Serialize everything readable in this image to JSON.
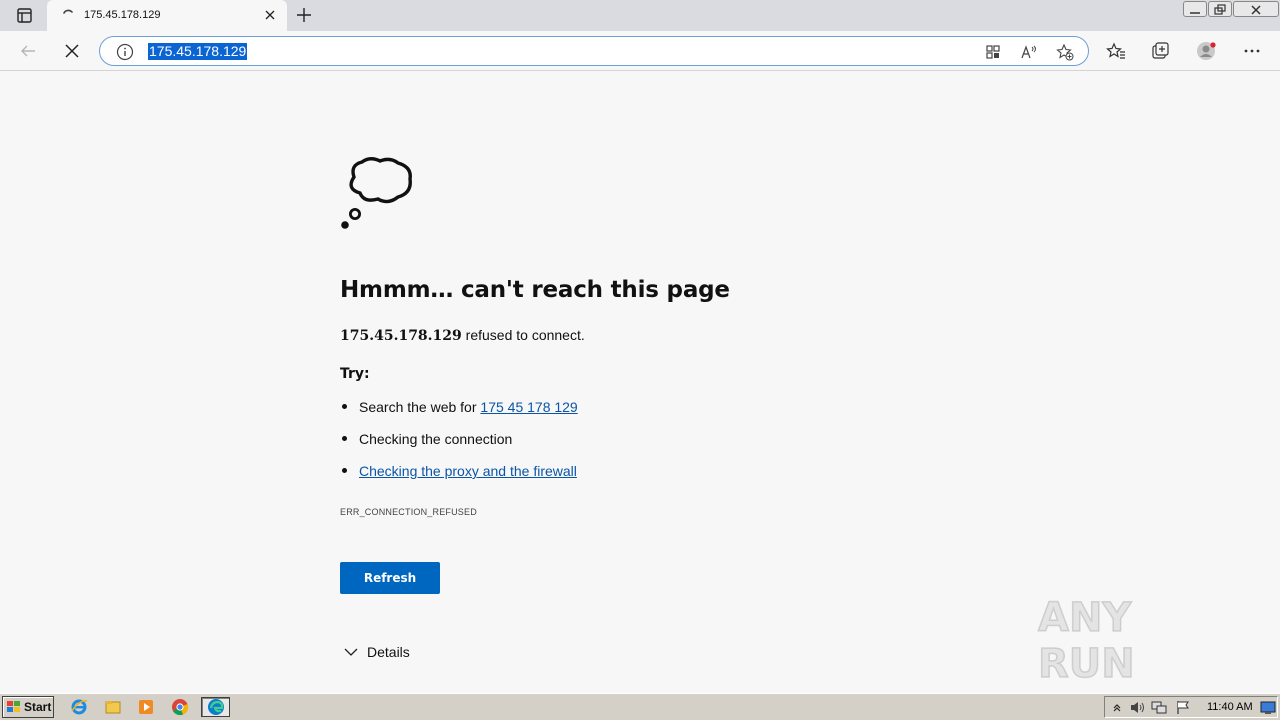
{
  "browser": {
    "tab": {
      "title": "175.45.178.129"
    },
    "address_bar": {
      "url": "175.45.178.129"
    }
  },
  "error_page": {
    "heading": "Hmmm… can't reach this page",
    "host": "175.45.178.129",
    "refused_text": " refused to connect.",
    "try_label": "Try:",
    "suggestions": {
      "search_prefix": "Search the web for ",
      "search_link": "175 45 178 129",
      "connection": "Checking the connection",
      "proxy_link": "Checking the proxy and the firewall"
    },
    "error_code": "ERR_CONNECTION_REFUSED",
    "refresh_button": "Refresh",
    "details_label": "Details"
  },
  "watermark": {
    "text": "ANY RUN"
  },
  "taskbar": {
    "start_label": "Start",
    "clock": "11:40 AM",
    "pinned_apps": [
      "internet-explorer-icon",
      "file-explorer-icon",
      "media-player-icon",
      "chrome-icon",
      "edge-icon"
    ]
  },
  "colors": {
    "accent": "#0067c0",
    "link": "#0b55a6",
    "address_selection": "#0a64d2",
    "page_background": "#f7f7f7"
  }
}
